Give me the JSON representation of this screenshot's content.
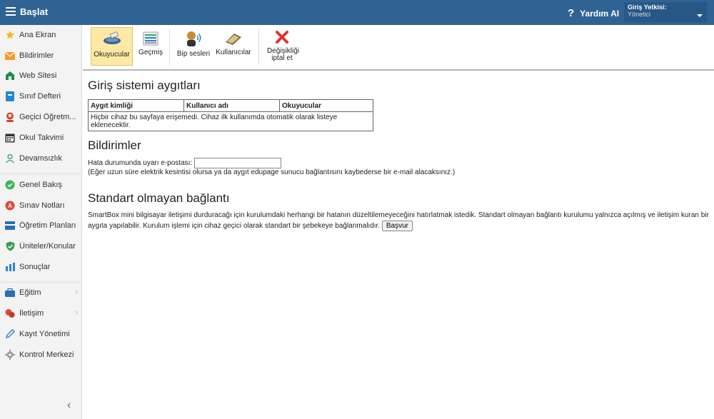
{
  "topbar": {
    "menu_icon": "hamburger-icon",
    "title": "Başlat",
    "help_label": "Yardım AI",
    "role_label": "Giriş Yetkisi:",
    "role_value": "Yönetici"
  },
  "sidebar": {
    "items": [
      {
        "label": "Ana Ekran",
        "icon": "star-icon"
      },
      {
        "label": "Bildirimler",
        "icon": "envelope-icon"
      },
      {
        "label": "Web Sitesi",
        "icon": "home-icon"
      },
      {
        "label": "Sınıf Defteri",
        "icon": "notebook-icon"
      },
      {
        "label": "Geçici Öğretm...",
        "icon": "person-icon"
      },
      {
        "label": "Okul Takvimi",
        "icon": "calendar-icon"
      },
      {
        "label": "Devamsızlık",
        "icon": "user-outline-icon"
      },
      {
        "label": "Genel Bakış",
        "icon": "check-circle-icon"
      },
      {
        "label": "Sınav Notları",
        "icon": "grade-icon"
      },
      {
        "label": "Öğretim Planları",
        "icon": "plan-icon"
      },
      {
        "label": "Üniteler/Konular",
        "icon": "shield-check-icon"
      },
      {
        "label": "Sonuçlar",
        "icon": "bar-chart-icon"
      },
      {
        "label": "Eğitim",
        "icon": "education-icon"
      },
      {
        "label": "İletişim",
        "icon": "chat-icon"
      },
      {
        "label": "Kayıt Yönetimi",
        "icon": "pen-icon"
      },
      {
        "label": "Kontrol Merkezi",
        "icon": "gear-icon"
      }
    ],
    "collapse_glyph": "‹"
  },
  "toolbar": {
    "buttons": [
      {
        "label": "Okuyucular",
        "icon": "card-reader-icon",
        "active": true
      },
      {
        "label": "Geçmiş",
        "icon": "history-list-icon",
        "active": false
      },
      {
        "label": "Bip sesleri",
        "icon": "speaker-person-icon",
        "active": false
      },
      {
        "label": "Kullanıcılar",
        "icon": "users-card-icon",
        "active": false
      },
      {
        "label": "Değişikliği iptal et",
        "icon": "red-x-icon",
        "active": false
      }
    ]
  },
  "devices": {
    "heading": "Giriş sistemi aygıtları",
    "columns": [
      "Aygıt kimliği",
      "Kullanıcı adı",
      "Okuyucular"
    ],
    "empty_message": "Hiçbir cihaz bu sayfaya erişemedi. Cihaz ilk kullanımda otomatik olarak listeye eklenecektir."
  },
  "notifications": {
    "heading": "Bildirimler",
    "email_label": "Hata durumunda uyarı e-postası:",
    "email_value": "",
    "note": "(Eğer uzun süre elektrik kesintisi olursa ya da aygıt edupage sunucu bağlantısını kaybederse bir e-mail alacaksınız.)"
  },
  "nonstandard": {
    "heading": "Standart olmayan bağlantı",
    "text": "SmartBox mini bilgisayar iletişimi durduracağı için kurulumdaki herhangi bir hatanın düzeltilemeyeceğini hatırlatmak istedik. Standart olmayan bağlantı kurulumu yalnızca açılmış ve iletişim kuran bir aygıta yapılabilir. Kurulum işlemi için cihaz geçici olarak standart bir şebekeye bağlanmalıdır.",
    "apply_label": "Başvur"
  }
}
